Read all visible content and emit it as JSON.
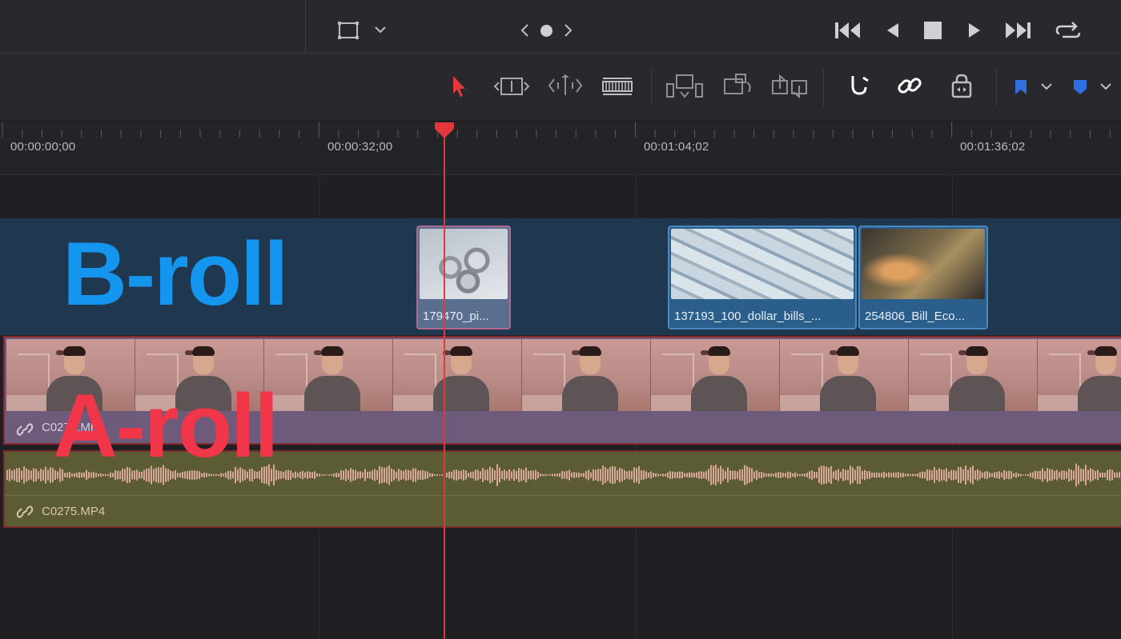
{
  "timecodes": {
    "t0": "00:00:00;00",
    "t1": "00:00:32;00",
    "t2": "00:01:04;02",
    "t3": "00:01:36;02"
  },
  "broll": {
    "label": "B-roll",
    "clips": [
      {
        "name": "179470_pi..."
      },
      {
        "name": "137193_100_dollar_bills_..."
      },
      {
        "name": "254806_Bill_Eco..."
      }
    ]
  },
  "aroll": {
    "label": "A-roll",
    "video_clip": "C0275.MP4",
    "audio_clip": "C0275.MP4"
  },
  "colors": {
    "playhead": "#e2383c",
    "broll_label": "#1596ee",
    "aroll_label": "#f1364a",
    "active_tool": "#e8383c",
    "flag": "#2f6fe0"
  },
  "icons": [
    "viewer-layout-icon",
    "dropdown-chevron-icon",
    "previous-nav-icon",
    "dot-indicator-icon",
    "next-nav-icon",
    "skip-to-start-icon",
    "reverse-play-icon",
    "stop-icon",
    "play-icon",
    "skip-to-end-icon",
    "loop-icon",
    "selection-arrow-icon",
    "trim-edit-icon",
    "dynamic-trim-icon",
    "blade-icon",
    "insert-clip-icon",
    "overwrite-clip-icon",
    "replace-clip-icon",
    "snapping-magnet-icon",
    "linked-selection-icon",
    "position-lock-icon",
    "flag-icon",
    "marker-icon",
    "link-icon"
  ]
}
